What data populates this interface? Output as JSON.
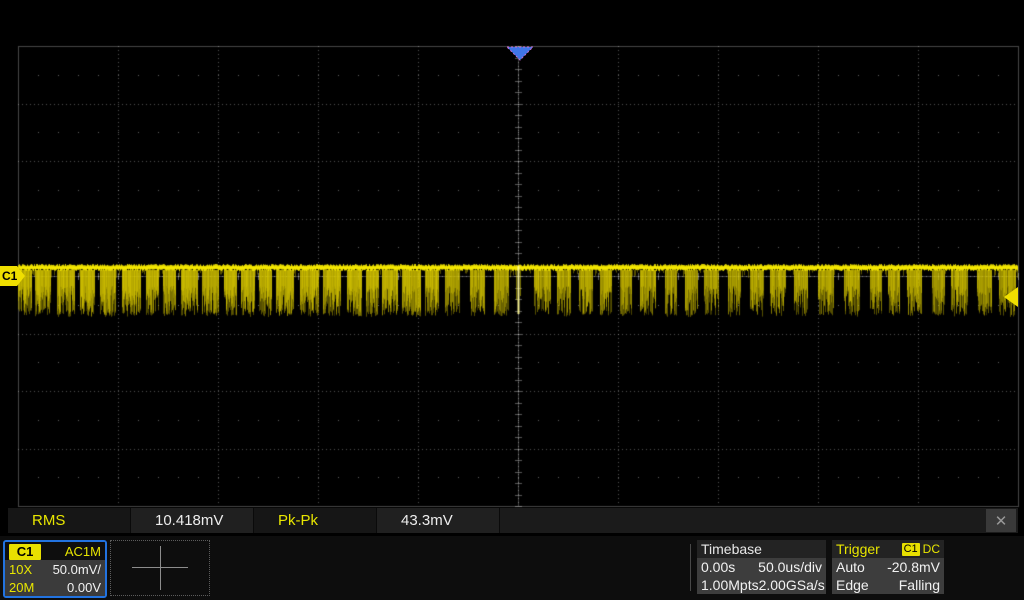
{
  "plot": {
    "channel_tag": "C1"
  },
  "measurements": {
    "items": [
      {
        "label": "RMS",
        "value": "10.418mV"
      },
      {
        "label": "Pk-Pk",
        "value": "43.3mV"
      }
    ]
  },
  "icons": {
    "close": "✕"
  },
  "channel_panel": {
    "channel": "C1",
    "coupling": "AC1M",
    "attenuation": "10X",
    "vertical_scale": "50.0mV/",
    "bandwidth_limit": "20M",
    "offset": "0.00V"
  },
  "timebase_panel": {
    "title": "Timebase",
    "delay": "0.00s",
    "horizontal_scale": "50.0us/div",
    "memory_depth": "1.00Mpts",
    "sample_rate": "2.00GSa/s"
  },
  "trigger_panel": {
    "title": "Trigger",
    "source": "C1",
    "coupling": "DC",
    "mode": "Auto",
    "level": "-20.8mV",
    "type": "Edge",
    "slope": "Falling"
  },
  "colors": {
    "trace": "#f5e800",
    "trace_dim": "rgba(214,198,0,",
    "accent_yellow": "#e8e600",
    "channel_border_blue": "#2273e0",
    "trigger_marker_blue": "#3f75e8",
    "grid_dot": "rgba(255,255,255,0.32)",
    "grid_border": "rgba(255,255,255,0.28)"
  }
}
